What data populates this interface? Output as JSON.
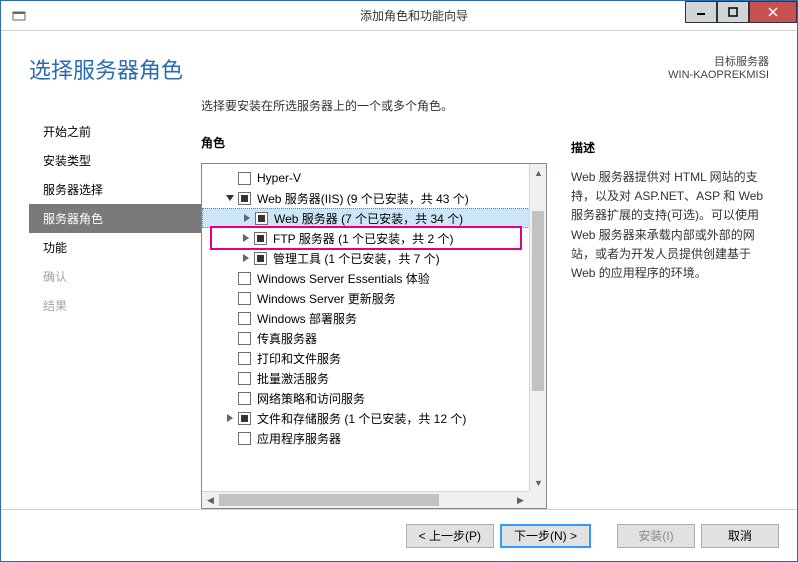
{
  "window": {
    "title": "添加角色和功能向导"
  },
  "header": {
    "page_title": "选择服务器角色",
    "target_label": "目标服务器",
    "target_server": "WIN-KAOPREKMISI"
  },
  "sidebar": {
    "items": [
      {
        "label": "开始之前",
        "state": "normal"
      },
      {
        "label": "安装类型",
        "state": "normal"
      },
      {
        "label": "服务器选择",
        "state": "normal"
      },
      {
        "label": "服务器角色",
        "state": "active"
      },
      {
        "label": "功能",
        "state": "normal"
      },
      {
        "label": "确认",
        "state": "disabled"
      },
      {
        "label": "结果",
        "state": "disabled"
      }
    ]
  },
  "center": {
    "instruction": "选择要安装在所选服务器上的一个或多个角色。",
    "roles_heading": "角色",
    "tree": [
      {
        "indent": 1,
        "twisty": "none",
        "check": "empty",
        "label": "Hyper-V",
        "selected": false
      },
      {
        "indent": 1,
        "twisty": "open",
        "check": "partial",
        "label": "Web 服务器(IIS) (9 个已安装，共 43 个)",
        "selected": false
      },
      {
        "indent": 2,
        "twisty": "closed",
        "check": "partial",
        "label": "Web 服务器 (7 个已安装，共 34 个)",
        "selected": true
      },
      {
        "indent": 2,
        "twisty": "closed",
        "check": "partial",
        "label": "FTP 服务器 (1 个已安装，共 2 个)",
        "selected": false,
        "highlight": true
      },
      {
        "indent": 2,
        "twisty": "closed",
        "check": "partial",
        "label": "管理工具 (1 个已安装，共 7 个)",
        "selected": false
      },
      {
        "indent": 1,
        "twisty": "none",
        "check": "empty",
        "label": "Windows Server Essentials 体验",
        "selected": false
      },
      {
        "indent": 1,
        "twisty": "none",
        "check": "empty",
        "label": "Windows Server 更新服务",
        "selected": false
      },
      {
        "indent": 1,
        "twisty": "none",
        "check": "empty",
        "label": "Windows 部署服务",
        "selected": false
      },
      {
        "indent": 1,
        "twisty": "none",
        "check": "empty",
        "label": "传真服务器",
        "selected": false
      },
      {
        "indent": 1,
        "twisty": "none",
        "check": "empty",
        "label": "打印和文件服务",
        "selected": false
      },
      {
        "indent": 1,
        "twisty": "none",
        "check": "empty",
        "label": "批量激活服务",
        "selected": false
      },
      {
        "indent": 1,
        "twisty": "none",
        "check": "empty",
        "label": "网络策略和访问服务",
        "selected": false
      },
      {
        "indent": 1,
        "twisty": "closed",
        "check": "partial",
        "label": "文件和存储服务 (1 个已安装，共 12 个)",
        "selected": false
      },
      {
        "indent": 1,
        "twisty": "none",
        "check": "empty",
        "label": "应用程序服务器",
        "selected": false
      }
    ]
  },
  "right": {
    "desc_heading": "描述",
    "desc_text": "Web 服务器提供对 HTML 网站的支持，以及对 ASP.NET、ASP 和 Web 服务器扩展的支持(可选)。可以使用 Web 服务器来承载内部或外部的网站，或者为开发人员提供创建基于 Web 的应用程序的环境。"
  },
  "buttons": {
    "prev": "< 上一步(P)",
    "next": "下一步(N) >",
    "install": "安装(I)",
    "cancel": "取消"
  }
}
